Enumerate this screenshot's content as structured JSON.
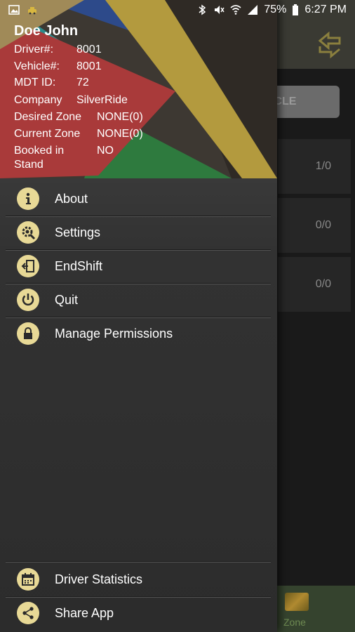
{
  "status_bar": {
    "battery": "75%",
    "time": "6:27 PM"
  },
  "header": {
    "name": "Doe John",
    "rows": [
      {
        "label": "Driver#:",
        "value": "8001"
      },
      {
        "label": "Vehicle#:",
        "value": "8001"
      },
      {
        "label": "MDT ID:",
        "value": "72"
      },
      {
        "label": "Company",
        "value": "SilverRide"
      },
      {
        "label": "Desired Zone",
        "value": "NONE(0)"
      },
      {
        "label": "Current Zone",
        "value": "NONE(0)"
      },
      {
        "label": "Booked in",
        "label2": "Stand",
        "value": "NO"
      }
    ]
  },
  "menu": [
    {
      "label": "About",
      "icon": "info-icon"
    },
    {
      "label": "Settings",
      "icon": "settings-icon"
    },
    {
      "label": "EndShift",
      "icon": "end-shift-icon"
    },
    {
      "label": "Quit",
      "icon": "power-icon"
    },
    {
      "label": "Manage Permissions",
      "icon": "lock-icon"
    }
  ],
  "bottom_menu": [
    {
      "label": "Driver Statistics",
      "icon": "calendar-icon"
    },
    {
      "label": "Share App",
      "icon": "share-icon"
    }
  ],
  "background": {
    "button_label": "ICLE",
    "rows": [
      "1/0",
      "0/0",
      "0/0"
    ],
    "zone_label": "Zone"
  },
  "colors": {
    "icon_bg": "#e8d996",
    "drawer_bg": "#323232"
  }
}
